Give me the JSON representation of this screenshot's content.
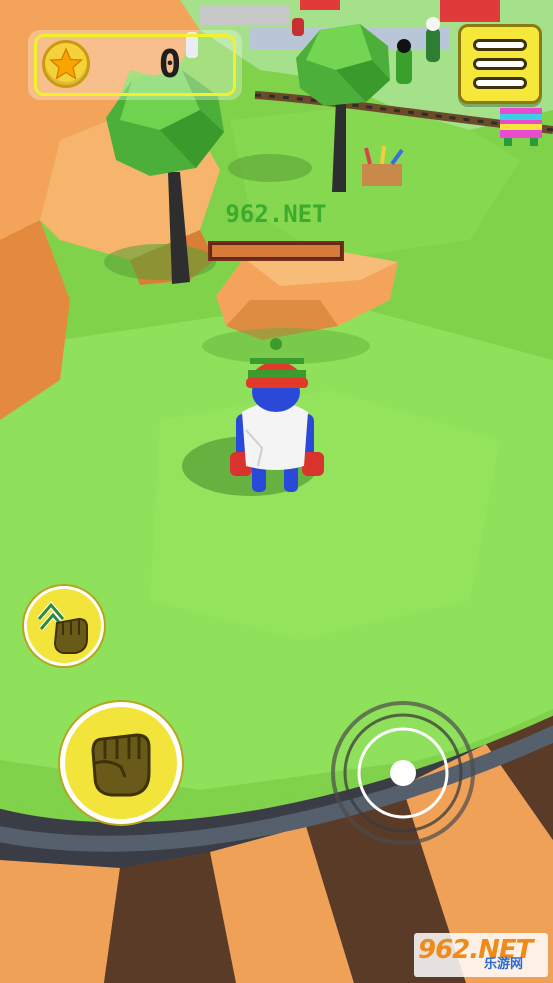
{
  "hud": {
    "coins": "0",
    "coin_icon": "star-coin-icon",
    "menu_icon": "hamburger-menu-icon"
  },
  "player": {
    "name": "962.NET",
    "health_fraction": 1.0
  },
  "controls": {
    "grab_icon": "grab-fist-icon",
    "punch_icon": "punch-fist-icon",
    "joystick_icon": "joystick-icon"
  },
  "watermark": {
    "logo": "962.NET",
    "sub": "乐游网"
  },
  "colors": {
    "grass": "#7fd24a",
    "cliff": "#f3a45a",
    "button_yellow": "#f3e43c",
    "player_blue": "#2b49d8"
  }
}
